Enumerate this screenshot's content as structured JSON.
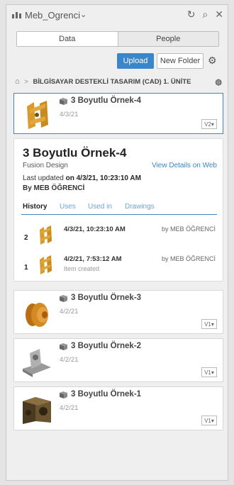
{
  "topbar": {
    "team_name": "Meb_Ogrenci",
    "chevron": "⌄",
    "refresh_icon": "↻",
    "search_icon": "⌕",
    "close_icon": "✕"
  },
  "tabs": [
    {
      "label": "Data"
    },
    {
      "label": "People"
    }
  ],
  "actions": {
    "upload_label": "Upload",
    "new_folder_label": "New Folder",
    "gear_icon": "⚙"
  },
  "breadcrumb": {
    "home_icon": "⌂",
    "separator": ">",
    "folder": "BİLGİSAYAR DESTEKLİ TASARIM (CAD) 1. ÜNİTE",
    "globe_icon": "◍"
  },
  "items": [
    {
      "name": "3 Boyutlu Örnek-4",
      "date": "4/3/21",
      "version": "V2▾"
    },
    {
      "name": "3 Boyutlu Örnek-3",
      "date": "4/2/21",
      "version": "V1▾"
    },
    {
      "name": "3 Boyutlu Örnek-2",
      "date": "4/2/21",
      "version": "V1▾"
    },
    {
      "name": "3 Boyutlu Örnek-1",
      "date": "4/2/21",
      "version": "V1▾"
    }
  ],
  "detail": {
    "title": "3 Boyutlu Örnek-4",
    "subtitle": "Fusion Design",
    "link": "View Details on Web",
    "updated_prefix": "Last updated",
    "updated_value": "on 4/3/21, 10:23:10 AM",
    "by": "By MEB ÖĞRENCİ",
    "tabs": [
      "History",
      "Uses",
      "Used in",
      "Drawings"
    ],
    "history": [
      {
        "num": "2",
        "time": "4/3/21, 10:23:10 AM",
        "by": "by MEB ÖĞRENCİ",
        "note": ""
      },
      {
        "num": "1",
        "time": "4/2/21, 7:53:12 AM",
        "by": "by MEB ÖĞRENCİ",
        "note": "Item created"
      }
    ]
  },
  "colors": {
    "accent": "#3a86c8",
    "thumb_orange": "#d89a2a"
  }
}
